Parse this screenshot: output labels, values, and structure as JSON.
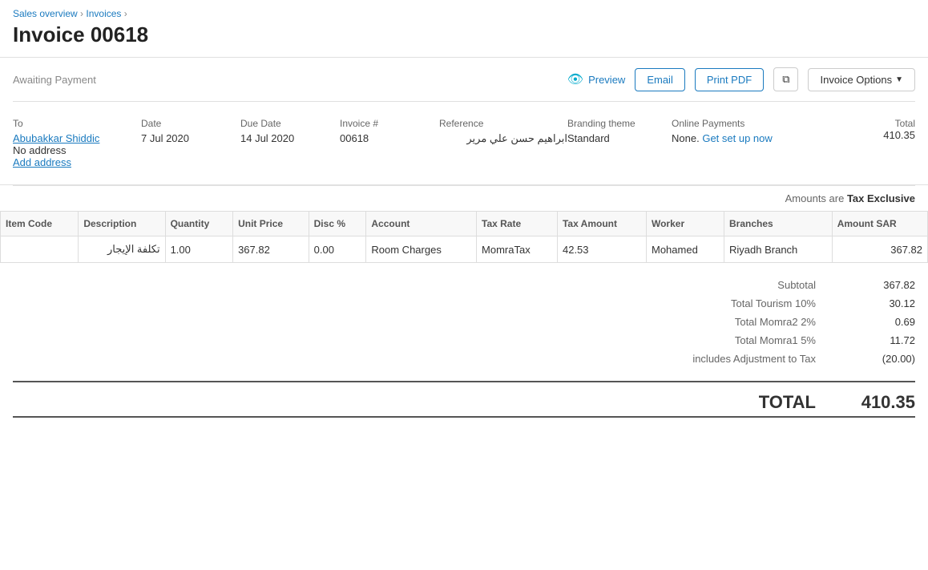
{
  "breadcrumb": {
    "sales_overview": "Sales overview",
    "separator1": " › ",
    "invoices": "Invoices",
    "separator2": " › "
  },
  "page": {
    "title": "Invoice 00618"
  },
  "status": {
    "label": "Awaiting Payment"
  },
  "toolbar": {
    "preview_label": "Preview",
    "email_label": "Email",
    "print_pdf_label": "Print PDF",
    "invoice_options_label": "Invoice Options"
  },
  "meta": {
    "to_label": "To",
    "date_label": "Date",
    "due_date_label": "Due Date",
    "invoice_num_label": "Invoice #",
    "reference_label": "Reference",
    "branding_theme_label": "Branding theme",
    "online_payments_label": "Online Payments",
    "total_label": "Total",
    "customer_name": "Abubakkar Shiddic",
    "no_address": "No address",
    "add_address": "Add address",
    "date_value": "7 Jul 2020",
    "due_date_value": "14 Jul 2020",
    "invoice_num_value": "00618",
    "reference_value": "ابراهيم حسن علي مرير",
    "branding_theme_value": "Standard",
    "online_payments_none": "None.",
    "get_set_up": "Get set up now",
    "total_value": "410.35"
  },
  "amounts_note": {
    "prefix": "Amounts are",
    "tax_type": "Tax Exclusive"
  },
  "table": {
    "headers": {
      "item_code": "Item Code",
      "description": "Description",
      "quantity": "Quantity",
      "unit_price": "Unit Price",
      "disc_pct": "Disc %",
      "account": "Account",
      "tax_rate": "Tax Rate",
      "tax_amount": "Tax Amount",
      "worker": "Worker",
      "branches": "Branches",
      "amount_sar": "Amount SAR"
    },
    "rows": [
      {
        "item_code": "",
        "description": "تكلفة الإيجار",
        "quantity": "1.00",
        "unit_price": "367.82",
        "disc_pct": "0.00",
        "account": "Room Charges",
        "tax_rate": "MomraTax",
        "tax_amount": "42.53",
        "worker": "Mohamed",
        "branches": "Riyadh Branch",
        "amount_sar": "367.82"
      }
    ]
  },
  "totals": {
    "subtotal_label": "Subtotal",
    "subtotal_value": "367.82",
    "tourism_label": "Total Tourism 10%",
    "tourism_value": "30.12",
    "momra2_label": "Total Momra2 2%",
    "momra2_value": "0.69",
    "momra1_label": "Total Momra1 5%",
    "momra1_value": "11.72",
    "adjustment_label": "includes Adjustment to Tax",
    "adjustment_value": "(20.00)",
    "total_label": "TOTAL",
    "total_value": "410.35"
  }
}
